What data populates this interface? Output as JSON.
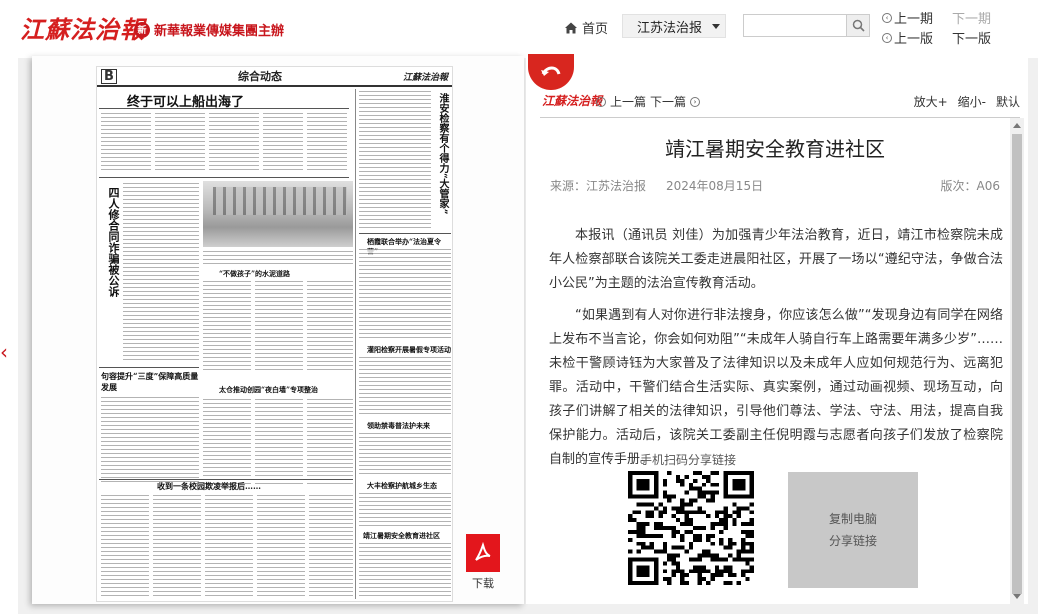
{
  "header": {
    "logo_text": "江蘇法治報",
    "group_text": "新華報業傳媒集團主辦",
    "home_label": "首页",
    "edition_label": "江苏法治报",
    "search_placeholder": "",
    "prev_issue": "上一期",
    "next_issue": "下一期",
    "prev_page": "上一版",
    "next_page": "下一版"
  },
  "newspaper": {
    "page_letter": "B",
    "section": "综合动态",
    "masthead": "江蘇法治報",
    "headlines": [
      "终于可以上船出海了",
      "四人修合同诈骗被公诉",
      "句容提升“三度”保障高质量发展",
      "“不做孩子”的水泥道路",
      "太仓推动创园“夜白墙”专项整治",
      "收到一条校园欺凌举报后……",
      "淮安检察有个得力“大管家”",
      "栖霞联合举办“法治夏令营”",
      "灌阳检察开展暑假专项活动",
      "领助禁毒普法护未来",
      "大丰检察护航城乡生态",
      "靖江暑期安全教育进社区"
    ]
  },
  "download_label": "下载",
  "article": {
    "mini_logo": "江蘇法治報",
    "prev": "上一篇",
    "next": "下一篇",
    "zoom_in": "放大+",
    "zoom_out": "缩小-",
    "default": "默认",
    "title": "靖江暑期安全教育进社区",
    "source": "来源：江苏法治报",
    "date": "2024年08月15日",
    "edition": "版次：A06",
    "paragraphs": [
      "本报讯（通讯员 刘佳）为加强青少年法治教育，近日，靖江市检察院未成年人检察部联合该院关工委走进晨阳社区，开展了一场以“遵纪守法，争做合法小公民”为主题的法治宣传教育活动。",
      "“如果遇到有人对你进行非法搜身，你应该怎么做”“发现身边有同学在网络上发布不当言论，你会如何劝阻”“未成年人骑自行车上路需要年满多少岁”……未检干警顾诗钰为大家普及了法律知识以及未成年人应如何规范行为、远离犯罪。活动中，干警们结合生活实际、真实案例，通过动画视频、现场互动，向孩子们讲解了相关的法律知识，引导他们尊法、学法、守法、用法，提高自我保护能力。活动后，该院关工委副主任倪明霞与志愿者向孩子们发放了检察院自制的宣传手册。"
    ],
    "share_label": "手机扫码分享链接",
    "copy_line1": "复制电脑",
    "copy_line2": "分享链接"
  },
  "colors": {
    "brand_red": "#d51f1f",
    "pdf_red": "#e3161c"
  }
}
